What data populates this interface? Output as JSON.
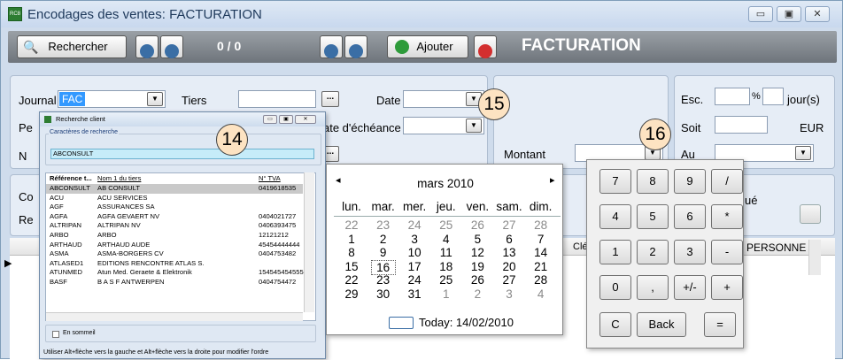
{
  "window": {
    "title": "Encodages des ventes:  FACTURATION",
    "app_icon_text": "RC8",
    "btn_min": "▭",
    "btn_max": "▣",
    "btn_close": "✕"
  },
  "toolbar": {
    "search_label": "Rechercher",
    "counter": "0 / 0",
    "add_label": "Ajouter",
    "screen_title": "FACTURATION"
  },
  "form": {
    "journal_label": "Journal",
    "journal_value": "FAC",
    "tiers_label": "Tiers",
    "tiers_value": "",
    "date_label": "Date",
    "date_value": "",
    "echeance_label": "ate d'échéance",
    "echeance_value": "",
    "montant_label": "Montant",
    "montant_value": "",
    "esc_label": "Esc.",
    "esc_value": "",
    "percent_label": "%",
    "jours_value": "",
    "jours_label": "jour(s)",
    "soit_label": "Soit",
    "soit_value": "",
    "eur_label": "EUR",
    "au_label": "Au",
    "au_value": "",
    "left_partial_1": "Pe",
    "left_partial_2": "N",
    "left_partial_3": "Co",
    "left_partial_4": "Re",
    "right_partial_ue": "ué",
    "cle_header": "Clé",
    "personne_header": "PERSONNE"
  },
  "callouts": {
    "c14": "14",
    "c15": "15",
    "c16": "16"
  },
  "recherche_client": {
    "title": "Recherche client",
    "search_group_label": "Caractères de recherche",
    "search_value": "ABCONSULT",
    "columns": [
      "Référence t...",
      "Nom 1 du tiers",
      "N° TVA"
    ],
    "rows": [
      [
        "ABCONSULT",
        "AB CONSULT",
        "0419618535"
      ],
      [
        "ACU",
        "ACU SERVICES",
        ""
      ],
      [
        "AGF",
        "ASSURANCES SA",
        ""
      ],
      [
        "AGFA",
        "AGFA GEVAERT NV",
        "0404021727"
      ],
      [
        "ALTRIPAN",
        "ALTRIPAN NV",
        "0406393475"
      ],
      [
        "ARBO",
        "ARBO",
        "12121212"
      ],
      [
        "ARTHAUD",
        "ARTHAUD AUDE",
        "45454444444"
      ],
      [
        "ASMA",
        "ASMA-BORGERS CV",
        "0404753482"
      ],
      [
        "ATLASED1",
        "EDITIONS RENCONTRE ATLAS S.A.",
        ""
      ],
      [
        "ATUNMED",
        "Atun Med. Geraete & Elektronik",
        "154545454555"
      ],
      [
        "BASF",
        "B A S F ANTWERPEN",
        "0404754472"
      ]
    ],
    "en_sommeil_label": "En sommeil",
    "hint": "Utiliser Alt+flèche vers la gauche et Alt+flèche vers la droite pour modifier l'ordre"
  },
  "calendar": {
    "month_label": "mars 2010",
    "prev_icon": "◂",
    "next_icon": "▸",
    "weekdays": [
      "lun.",
      "mar.",
      "mer.",
      "jeu.",
      "ven.",
      "sam.",
      "dim."
    ],
    "weeks": [
      [
        "22",
        "23",
        "24",
        "25",
        "26",
        "27",
        "28"
      ],
      [
        "1",
        "2",
        "3",
        "4",
        "5",
        "6",
        "7"
      ],
      [
        "8",
        "9",
        "10",
        "11",
        "12",
        "13",
        "14"
      ],
      [
        "15",
        "16",
        "17",
        "18",
        "19",
        "20",
        "21"
      ],
      [
        "22",
        "23",
        "24",
        "25",
        "26",
        "27",
        "28"
      ],
      [
        "29",
        "30",
        "31",
        "1",
        "2",
        "3",
        "4"
      ]
    ],
    "other_month_color": "#8a8a8a",
    "selected_day_index": [
      3,
      1
    ],
    "today_label": "Today: 14/02/2010"
  },
  "keypad": {
    "rows": [
      [
        "7",
        "8",
        "9",
        "/"
      ],
      [
        "4",
        "5",
        "6",
        "*"
      ],
      [
        "1",
        "2",
        "3",
        "-"
      ],
      [
        "0",
        ",",
        "+/-",
        "+"
      ]
    ],
    "clear": "C",
    "back": "Back",
    "equals": "="
  },
  "colors": {
    "toolbar": "#808690",
    "panel": "#e6edf6",
    "title_text": "#1e395b",
    "selection": "#c9c9c9",
    "search_highlight": "#c6ecf9",
    "callout_fill": "#fde3c2"
  }
}
